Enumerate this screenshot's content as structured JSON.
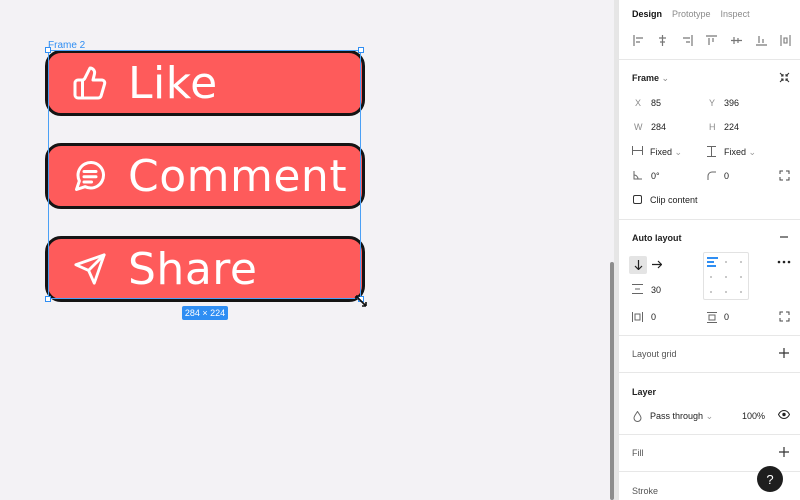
{
  "canvas": {
    "frame_label": "Frame 2",
    "size_badge": "284 × 224",
    "buttons": [
      {
        "label": "Like",
        "icon": "thumbs-up-icon"
      },
      {
        "label": "Comment",
        "icon": "comment-icon"
      },
      {
        "label": "Share",
        "icon": "send-icon"
      }
    ],
    "colors": {
      "button_fill": "#fe5b5b",
      "button_border": "#141414",
      "selection": "#2f8ef3"
    }
  },
  "panel": {
    "tabs": [
      {
        "label": "Design",
        "active": true
      },
      {
        "label": "Prototype",
        "active": false
      },
      {
        "label": "Inspect",
        "active": false
      }
    ],
    "frame": {
      "title": "Frame",
      "x_label": "X",
      "x": "85",
      "y_label": "Y",
      "y": "396",
      "w_label": "W",
      "w": "284",
      "h_label": "H",
      "h": "224",
      "horiz_resize": "Fixed",
      "vert_resize": "Fixed",
      "rotation": "0°",
      "radius": "0",
      "clip_label": "Clip content"
    },
    "auto_layout": {
      "title": "Auto layout",
      "spacing": "30",
      "padding_h": "0",
      "padding_v": "0"
    },
    "layout_grid": {
      "title": "Layout grid"
    },
    "layer": {
      "title": "Layer",
      "blend": "Pass through",
      "opacity": "100%"
    },
    "fill": {
      "title": "Fill"
    },
    "stroke": {
      "title": "Stroke"
    },
    "help": "?"
  }
}
